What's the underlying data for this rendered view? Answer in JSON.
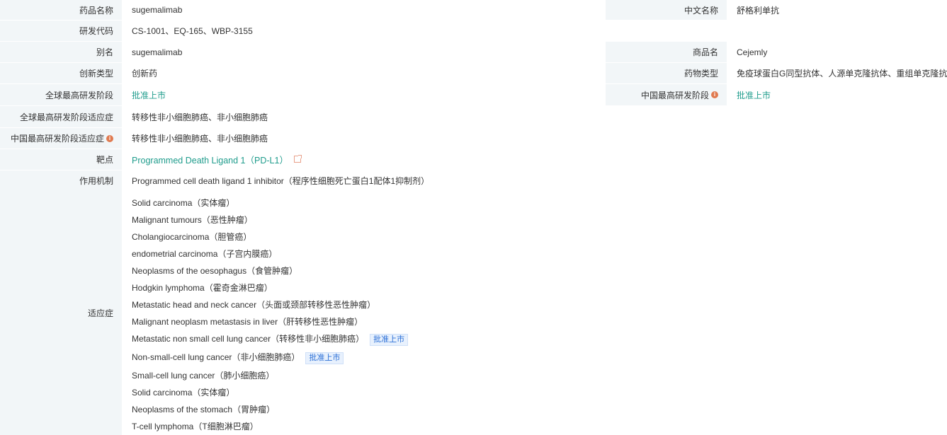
{
  "rows": {
    "drug_name": {
      "label": "药品名称",
      "value": "sugemalimab"
    },
    "chinese_name": {
      "label": "中文名称",
      "value": "舒格利单抗"
    },
    "rd_code": {
      "label": "研发代码",
      "value": "CS-1001、EQ-165、WBP-3155"
    },
    "alias": {
      "label": "别名",
      "value": "sugemalimab"
    },
    "trade_name": {
      "label": "商品名",
      "value": "Cejemly"
    },
    "innovation_type": {
      "label": "创新类型",
      "value": "创新药"
    },
    "drug_type": {
      "label": "药物类型",
      "value": "免疫球蛋白G同型抗体、人源单克隆抗体、重组单克隆抗体"
    },
    "global_stage": {
      "label": "全球最高研发阶段",
      "value": "批准上市"
    },
    "china_stage": {
      "label": "中国最高研发阶段",
      "value": "批准上市"
    },
    "global_stage_indication": {
      "label": "全球最高研发阶段适应症",
      "value": "转移性非小细胞肺癌、非小细胞肺癌"
    },
    "china_stage_indication": {
      "label": "中国最高研发阶段适应症",
      "value": "转移性非小细胞肺癌、非小细胞肺癌"
    },
    "target": {
      "label": "靶点",
      "value": "Programmed Death Ligand 1（PD-L1）"
    },
    "mechanism": {
      "label": "作用机制",
      "value": "Programmed cell death ligand 1 inhibitor（程序性细胞死亡蛋白1配体1抑制剂）"
    }
  },
  "indications": {
    "label": "适应症",
    "items": [
      {
        "text": "Solid carcinoma（实体瘤）",
        "badge": null
      },
      {
        "text": "Malignant tumours（恶性肿瘤）",
        "badge": null
      },
      {
        "text": "Cholangiocarcinoma（胆管癌）",
        "badge": null
      },
      {
        "text": "endometrial carcinoma（子宫内膜癌）",
        "badge": null
      },
      {
        "text": "Neoplasms of the oesophagus（食管肿瘤）",
        "badge": null
      },
      {
        "text": "Hodgkin lymphoma（霍奇金淋巴瘤）",
        "badge": null
      },
      {
        "text": "Metastatic head and neck cancer（头面或颈部转移性恶性肿瘤）",
        "badge": null
      },
      {
        "text": "Malignant neoplasm metastasis in liver（肝转移性恶性肿瘤）",
        "badge": null
      },
      {
        "text": "Metastatic non small cell lung cancer（转移性非小细胞肺癌）",
        "badge": "批准上市"
      },
      {
        "text": "Non-small-cell lung cancer（非小细胞肺癌）",
        "badge": "批准上市"
      },
      {
        "text": "Small-cell lung cancer（肺小细胞癌）",
        "badge": null
      },
      {
        "text": "Solid carcinoma（实体瘤）",
        "badge": null
      },
      {
        "text": "Neoplasms of the stomach（胃肿瘤）",
        "badge": null
      },
      {
        "text": "T-cell lymphoma（T细胞淋巴瘤）",
        "badge": null
      }
    ]
  },
  "colors": {
    "label_bg": "#f2f6f8",
    "link": "#1f9c8c",
    "badge_bg": "#e8f1fd",
    "badge_text": "#2b6fd6",
    "info_icon": "#e07a50"
  },
  "icons": {
    "info": "info-icon",
    "external_link": "external-link-icon"
  }
}
